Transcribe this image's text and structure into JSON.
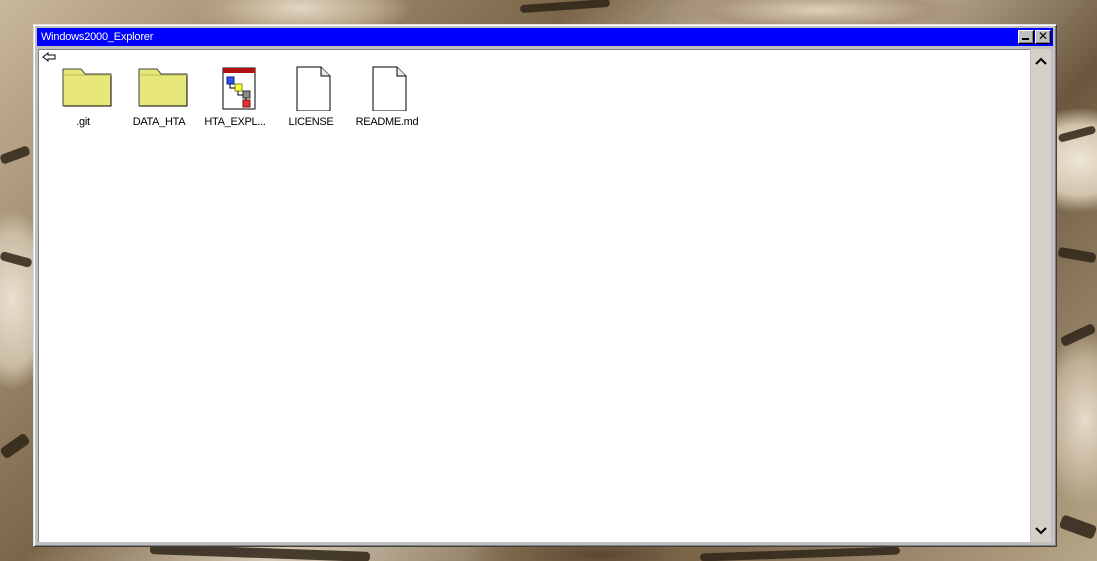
{
  "window": {
    "title": "Windows2000_Explorer"
  },
  "toolbar": {
    "back_icon": "back-arrow-icon"
  },
  "items": [
    {
      "label": ".git",
      "icon": "folder-icon"
    },
    {
      "label": "DATA_HTA",
      "icon": "folder-icon"
    },
    {
      "label": "HTA_EXPL...",
      "icon": "hta-application-icon"
    },
    {
      "label": "LICENSE",
      "icon": "document-icon"
    },
    {
      "label": "README.md",
      "icon": "document-icon"
    }
  ],
  "colors": {
    "titlebar": "#0000fe",
    "window_face": "#c0c0c0",
    "content_background": "#ffffff",
    "folder_fill": "#e8e87a"
  }
}
